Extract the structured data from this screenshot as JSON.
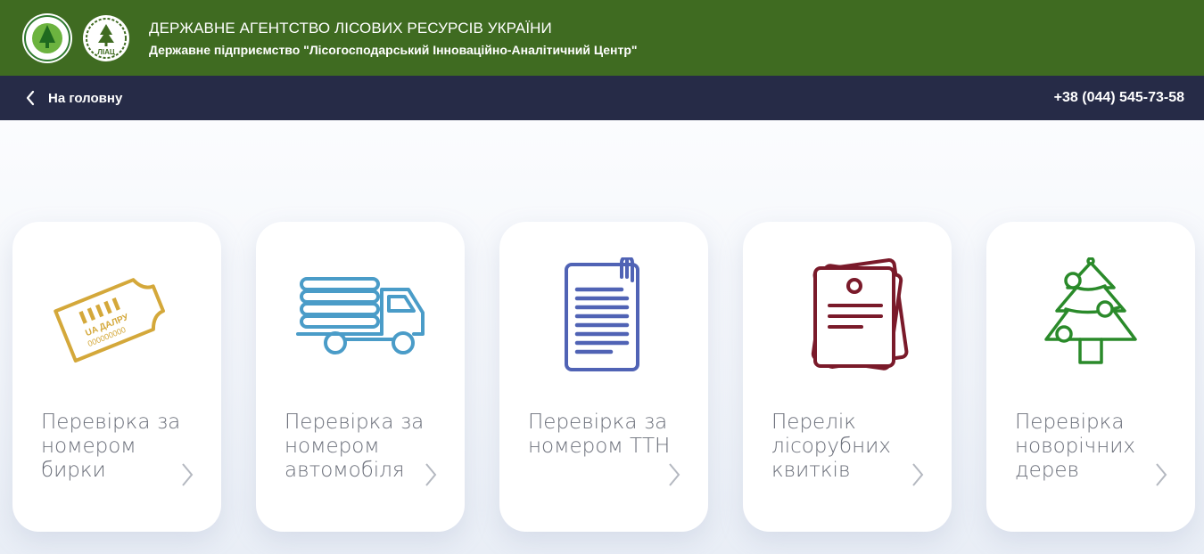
{
  "header": {
    "title": "ДЕРЖАВНЕ АГЕНТСТВО ЛІСОВИХ РЕСУРСІВ УКРАЇНИ",
    "subtitle": "Державне підприємство \"Лісогосподарський Інноваційно-Аналітичний Центр\"",
    "logo2_text": "ЛІАЦ"
  },
  "nav": {
    "back_label": "На головну",
    "phone": "+38 (044) 545-73-58"
  },
  "cards": [
    {
      "label": "Перевірка за номером бирки",
      "icon": "tag-icon",
      "color": "#d4a83a",
      "tag_line1": "UA ДАЛРУ",
      "tag_line2": "000000000"
    },
    {
      "label": "Перевірка за номером автомобіля",
      "icon": "truck-icon",
      "color": "#4a9cc8"
    },
    {
      "label": "Перевірка за номером ТТН",
      "icon": "document-icon",
      "color": "#5063b5"
    },
    {
      "label": "Перелік лісорубних квитків",
      "icon": "tickets-icon",
      "color": "#7a1a2a"
    },
    {
      "label": "Перевірка новорічних дерев",
      "icon": "christmas-tree-icon",
      "color": "#2a8a2a"
    }
  ]
}
